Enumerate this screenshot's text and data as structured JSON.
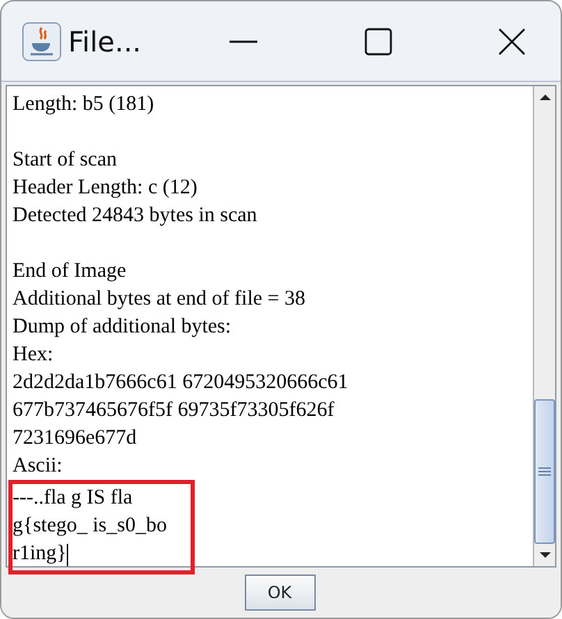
{
  "window": {
    "title": "File..."
  },
  "text_area": {
    "blocks": [
      {
        "kind": "paragraph",
        "lines": [
          "Length: b5 (181)"
        ]
      },
      {
        "kind": "paragraph",
        "lines": [
          "Start of scan",
          "Header Length: c (12)",
          "Detected 24843 bytes in scan"
        ]
      },
      {
        "kind": "paragraph",
        "lines": [
          "End of Image",
          "Additional bytes at end of file = 38",
          "Dump of additional bytes:",
          "Hex:",
          "2d2d2da1b7666c61 6720495320666c61",
          "677b737465676f5f 69735f73305f626f",
          "7231696e677d",
          "Ascii:"
        ]
      },
      {
        "kind": "highlight",
        "lines": [
          "---..fla g IS fla",
          "g{stego_ is_s0_bo",
          "r1ing}"
        ]
      }
    ]
  },
  "buttons": [
    "OK"
  ]
}
